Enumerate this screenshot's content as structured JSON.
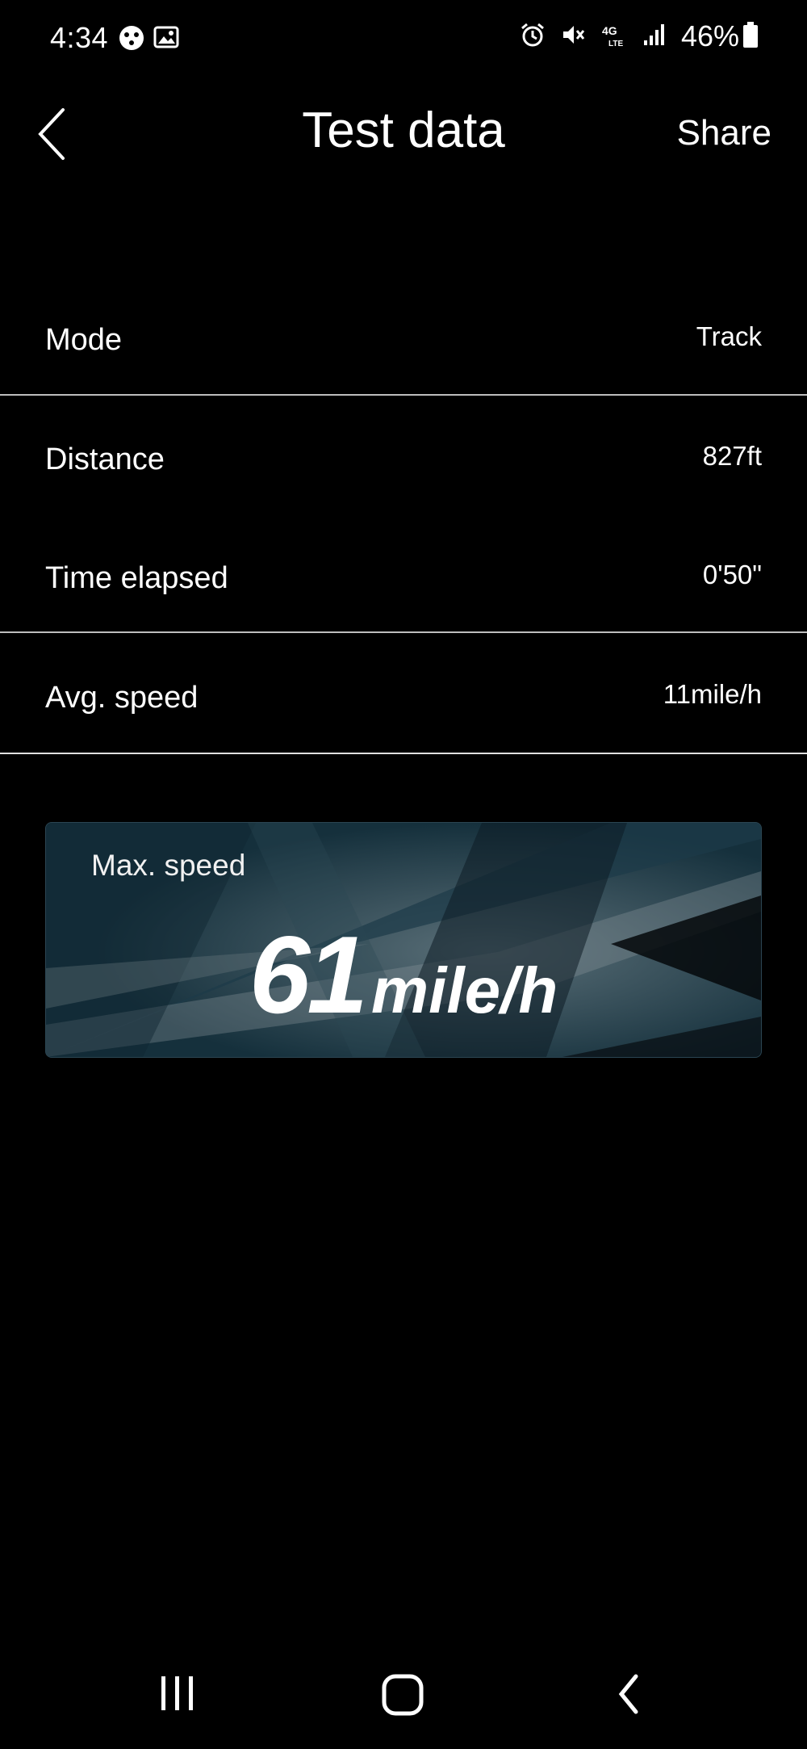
{
  "status_bar": {
    "time": "4:34",
    "battery": "46%",
    "left_icons": [
      "app-icon",
      "gallery-icon"
    ],
    "right_icons": [
      "alarm-icon",
      "mute-icon",
      "network-4g-lte-icon",
      "signal-icon",
      "battery-icon"
    ]
  },
  "header": {
    "title": "Test data",
    "share_label": "Share",
    "back_icon": "chevron-left-icon"
  },
  "rows": [
    {
      "label": "Mode",
      "value": "Track"
    },
    {
      "label": "Distance",
      "value": "827ft"
    },
    {
      "label": "Time elapsed",
      "value": "0'50\""
    },
    {
      "label": "Avg. speed",
      "value": "11mile/h"
    }
  ],
  "max_speed": {
    "label": "Max. speed",
    "value": "61",
    "unit": "mile/h"
  },
  "nav_bar": {
    "icons": [
      "recent-apps-icon",
      "home-icon",
      "back-icon"
    ]
  },
  "colors": {
    "background": "#000000",
    "divider": "#bdbdbd",
    "card_base": "#17303c"
  }
}
